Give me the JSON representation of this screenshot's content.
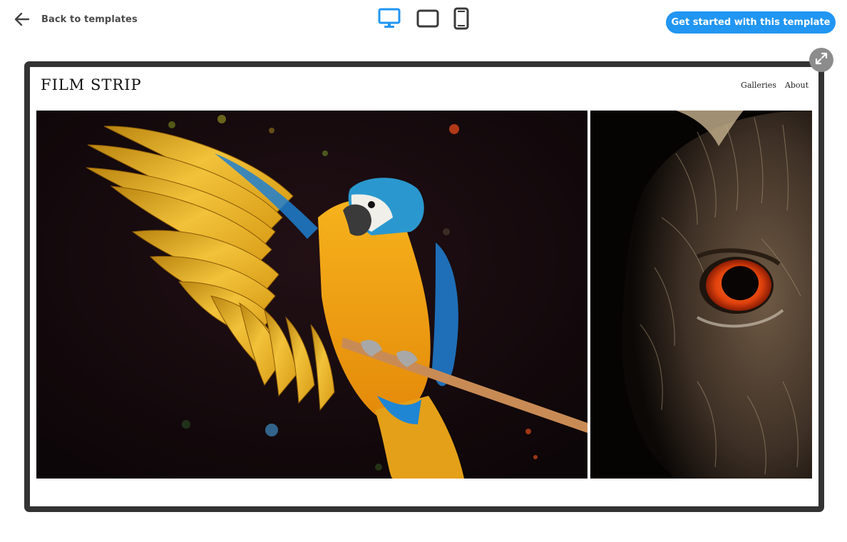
{
  "header": {
    "back_label": "Back to templates",
    "back_icon": "arrow-left-icon",
    "devices": [
      {
        "name": "desktop",
        "icon": "desktop-icon",
        "active": true
      },
      {
        "name": "tablet",
        "icon": "tablet-icon",
        "active": false
      },
      {
        "name": "phone",
        "icon": "phone-icon",
        "active": false
      }
    ],
    "cta_label": "Get started with this template"
  },
  "preview": {
    "expand_icon": "expand-icon",
    "site": {
      "title": "FILM STRIP",
      "nav": [
        "Galleries",
        "About"
      ]
    },
    "photos": [
      {
        "subject": "macaw parrot on perch"
      },
      {
        "subject": "owl eye close-up"
      }
    ]
  },
  "colors": {
    "accent": "#2196f3",
    "frame": "#333333",
    "text_muted": "#4a4a4a"
  }
}
